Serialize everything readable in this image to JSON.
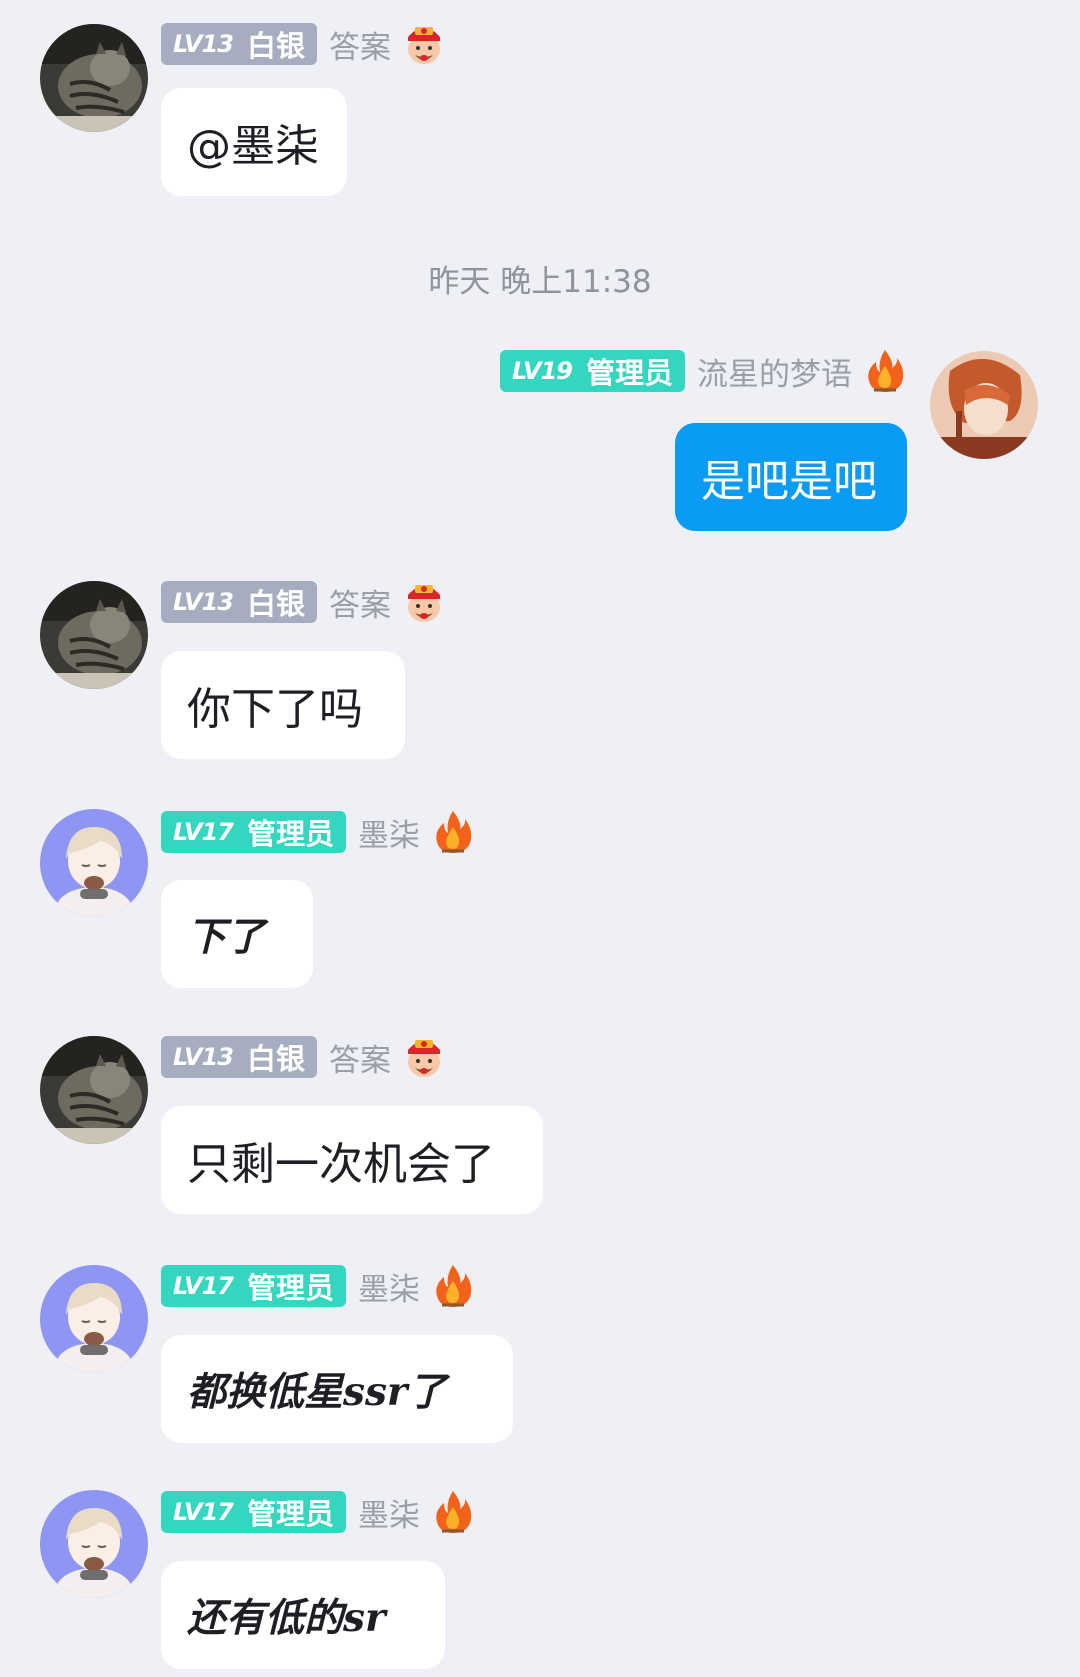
{
  "timestamp": "昨天 晚上11:38",
  "colors": {
    "background": "#eef0f5",
    "silver_badge": "#a6adc0",
    "admin_badge": "#34d6c0",
    "my_bubble": "#0a9cf5",
    "other_bubble": "#ffffff"
  },
  "messages": [
    {
      "sender": "答案",
      "level": "LV13",
      "title": "白银",
      "badge_icon": "fortune-god-icon",
      "text": "@墨柒",
      "side": "left"
    },
    {
      "sender": "流星的梦语",
      "level": "LV19",
      "title": "管理员",
      "badge_icon": "fire-icon",
      "text": "是吧是吧",
      "side": "right"
    },
    {
      "sender": "答案",
      "level": "LV13",
      "title": "白银",
      "badge_icon": "fortune-god-icon",
      "text": "你下了吗",
      "side": "left"
    },
    {
      "sender": "墨柒",
      "level": "LV17",
      "title": "管理员",
      "badge_icon": "fire-icon",
      "text": "下了",
      "side": "left"
    },
    {
      "sender": "答案",
      "level": "LV13",
      "title": "白银",
      "badge_icon": "fortune-god-icon",
      "text": "只剩一次机会了",
      "side": "left"
    },
    {
      "sender": "墨柒",
      "level": "LV17",
      "title": "管理员",
      "badge_icon": "fire-icon",
      "text": "都换低星ssr了",
      "side": "left"
    },
    {
      "sender": "墨柒",
      "level": "LV17",
      "title": "管理员",
      "badge_icon": "fire-icon",
      "text": "还有低的sr",
      "side": "left"
    }
  ]
}
